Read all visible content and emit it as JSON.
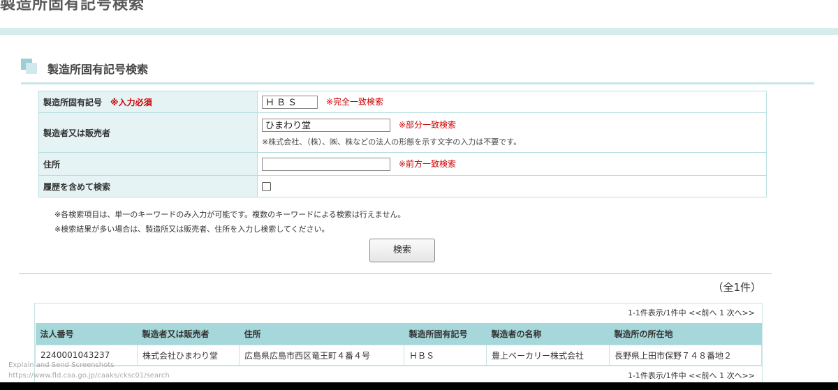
{
  "page": {
    "title": "製造所固有記号検索"
  },
  "section": {
    "title": "製造所固有記号検索"
  },
  "form": {
    "code": {
      "label": "製造所固有記号",
      "required": "※入力必須",
      "value": "ＨＢＳ",
      "note": "※完全一致検索"
    },
    "maker": {
      "label": "製造者又は販売者",
      "value": "ひまわり堂",
      "note": "※部分一致検索",
      "sub_note": "※株式会社、（株）、㈱、株などの法人の形態を示す文字の入力は不要です。"
    },
    "address": {
      "label": "住所",
      "value": "",
      "note": "※前方一致検索"
    },
    "history": {
      "label": "履歴を含めて検索",
      "checked": false
    }
  },
  "notes": [
    "※各検索項目は、単一のキーワードのみ入力が可能です。複数のキーワードによる検索は行えません。",
    "※検索結果が多い場合は、製造所又は販売者、住所を入力し検索してください。"
  ],
  "search_button": "検索",
  "total": "（全1件）",
  "pager": {
    "text": "1-1件表示/1件中",
    "prev": "<<前へ",
    "page": "1",
    "next": "次へ>>"
  },
  "results": {
    "headers": [
      "法人番号",
      "製造者又は販売者",
      "住所",
      "製造所固有記号",
      "製造者の名称",
      "製造所の所在地"
    ],
    "rows": [
      [
        "2240001043237",
        "株式会社ひまわり堂",
        "広島県広島市西区竜王町４番４号",
        "ＨＢＳ",
        "豊上ベーカリー株式会社",
        "長野県上田市保野７４８番地２"
      ]
    ]
  },
  "overlay": {
    "caption": "Explain and Send Screenshots",
    "url": "https://www.fld.caa.go.jp/caaks/cksc01/search"
  }
}
